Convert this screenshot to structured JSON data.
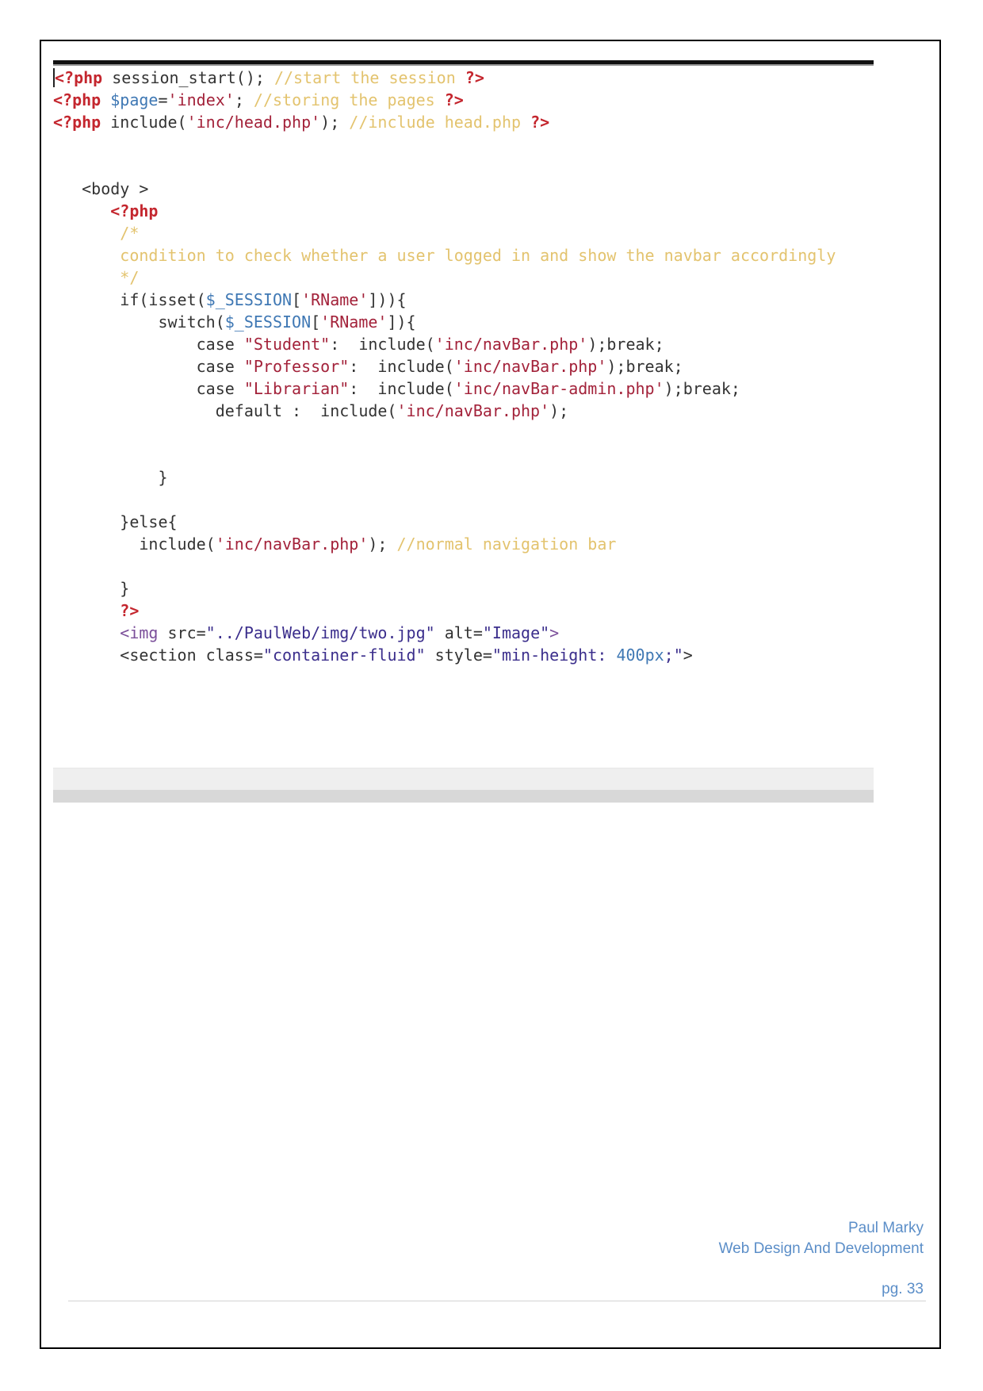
{
  "code_lines": [
    [
      [
        "kw",
        "<?php"
      ],
      [
        "tx",
        " session_start(); "
      ],
      [
        "cm",
        "//start the session "
      ],
      [
        "kw",
        "?>"
      ]
    ],
    [
      [
        "kw",
        "<?php"
      ],
      [
        "tx",
        " "
      ],
      [
        "vr",
        "$page"
      ],
      [
        "tx",
        "="
      ],
      [
        "st",
        "'index'"
      ],
      [
        "tx",
        "; "
      ],
      [
        "cm",
        "//storing the pages "
      ],
      [
        "kw",
        "?>"
      ]
    ],
    [
      [
        "kw",
        "<?php"
      ],
      [
        "tx",
        " include("
      ],
      [
        "st",
        "'inc/head.php'"
      ],
      [
        "tx",
        "); "
      ],
      [
        "cm",
        "//include head.php "
      ],
      [
        "kw",
        "?>"
      ]
    ],
    [],
    [],
    [
      [
        "tx",
        "   <body >"
      ]
    ],
    [
      [
        "kw",
        "      <?php"
      ]
    ],
    [
      [
        "cm",
        "       /*"
      ]
    ],
    [
      [
        "cm",
        "       condition to check whether a user logged in and show the navbar accordingly"
      ]
    ],
    [
      [
        "cm",
        "       */"
      ]
    ],
    [
      [
        "tx",
        "       if(isset("
      ],
      [
        "vr",
        "$_SESSION"
      ],
      [
        "tx",
        "["
      ],
      [
        "st",
        "'RName'"
      ],
      [
        "tx",
        "])){"
      ]
    ],
    [
      [
        "tx",
        "           switch("
      ],
      [
        "vr",
        "$_SESSION"
      ],
      [
        "tx",
        "["
      ],
      [
        "st",
        "'RName'"
      ],
      [
        "tx",
        "]){"
      ]
    ],
    [
      [
        "tx",
        "               case "
      ],
      [
        "st",
        "\"Student\""
      ],
      [
        "tx",
        ":  include("
      ],
      [
        "st",
        "'inc/navBar.php'"
      ],
      [
        "tx",
        ");break;"
      ]
    ],
    [
      [
        "tx",
        "               case "
      ],
      [
        "st",
        "\"Professor\""
      ],
      [
        "tx",
        ":  include("
      ],
      [
        "st",
        "'inc/navBar.php'"
      ],
      [
        "tx",
        ");break;"
      ]
    ],
    [
      [
        "tx",
        "               case "
      ],
      [
        "st",
        "\"Librarian\""
      ],
      [
        "tx",
        ":  include("
      ],
      [
        "st",
        "'inc/navBar-admin.php'"
      ],
      [
        "tx",
        ");break;"
      ]
    ],
    [
      [
        "tx",
        "                 default :  include("
      ],
      [
        "st",
        "'inc/navBar.php'"
      ],
      [
        "tx",
        ");"
      ]
    ],
    [],
    [],
    [
      [
        "tx",
        "           }"
      ]
    ],
    [],
    [
      [
        "tx",
        "       }else{"
      ]
    ],
    [
      [
        "tx",
        "         include("
      ],
      [
        "st",
        "'inc/navBar.php'"
      ],
      [
        "tx",
        "); "
      ],
      [
        "cm",
        "//normal navigation bar"
      ]
    ],
    [],
    [
      [
        "tx",
        "       }"
      ]
    ],
    [
      [
        "kw",
        "       ?>"
      ]
    ],
    [
      [
        "tg",
        "       <img "
      ],
      [
        "tx",
        "src="
      ],
      [
        "av",
        "\"../PaulWeb/img/two.jpg\""
      ],
      [
        "tx",
        " alt="
      ],
      [
        "av",
        "\"Image\""
      ],
      [
        "tg",
        ">"
      ]
    ],
    [
      [
        "tx",
        "       <section class="
      ],
      [
        "av",
        "\"container-fluid\""
      ],
      [
        "tx",
        " style="
      ],
      [
        "av",
        "\"min-height: "
      ],
      [
        "vr",
        "400px"
      ],
      [
        "av",
        ";\""
      ],
      [
        "tx",
        ">"
      ]
    ]
  ],
  "footer": {
    "author": "Paul Marky",
    "course": "Web Design And Development",
    "page": "pg. 33"
  },
  "colors": {
    "footer_text": "#5b8ec8",
    "php_tag": "#c4262e",
    "comment": "#e3c36e",
    "string": "#a3223a"
  }
}
